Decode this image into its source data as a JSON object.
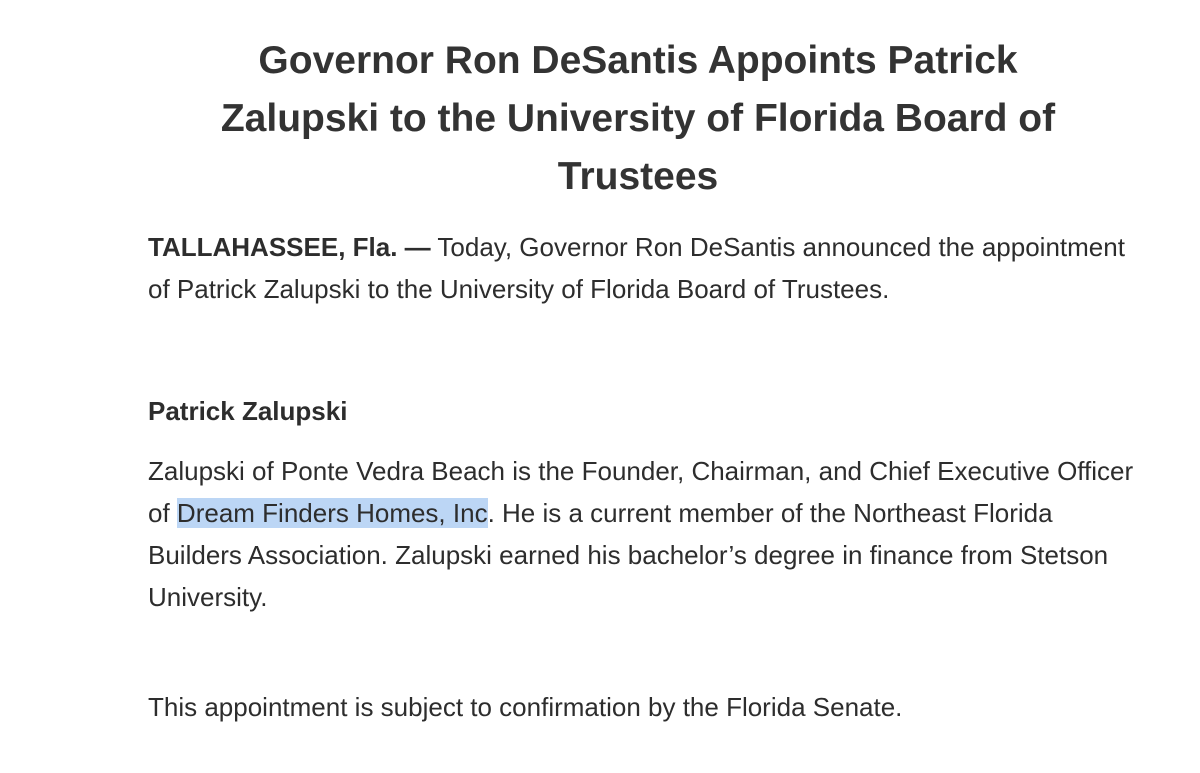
{
  "document": {
    "title_lines": [
      "Governor Ron DeSantis Appoints Patrick",
      "Zalupski to the University of Florida Board of",
      "Trustees"
    ],
    "dateline": "TALLAHASSEE, Fla. —",
    "intro": " Today, Governor Ron DeSantis announced the appointment of Patrick Zalupski to the University of Florida Board of Trustees.",
    "appointee_name": "Patrick Zalupski",
    "bio_before_highlight": "Zalupski of Ponte Vedra Beach is the Founder, Chairman, and Chief Executive Officer of ",
    "bio_highlight": "Dream Finders Homes, Inc",
    "bio_after_highlight": ". He is a current member of the Northeast Florida Builders Association. Zalupski earned his bachelor’s degree in finance from Stetson University.",
    "confirmation_note": "This appointment is subject to confirmation by the Florida Senate."
  },
  "colors": {
    "text": "#2d2d2d",
    "title": "#333333",
    "selection_highlight": "#bcd6f5",
    "background": "#ffffff"
  }
}
